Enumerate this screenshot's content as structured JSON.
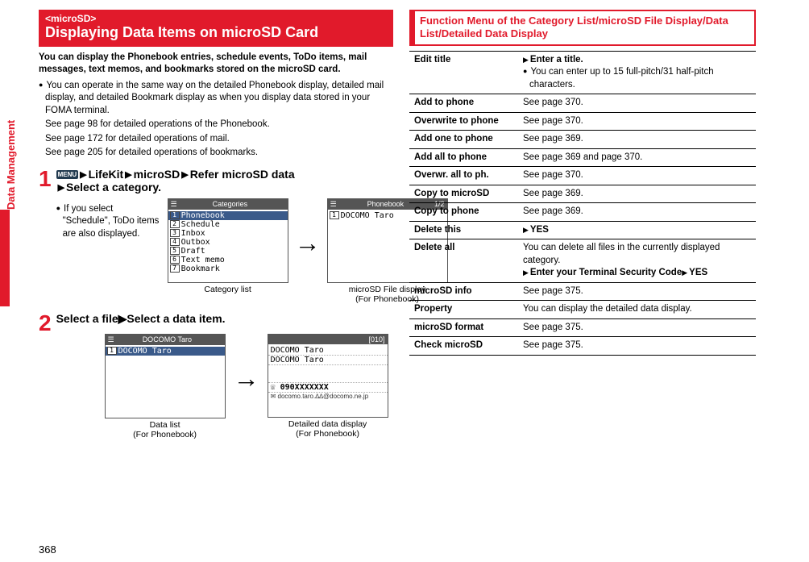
{
  "side": "Data Management",
  "left": {
    "box_tag": "<microSD>",
    "title": "Displaying Data Items on microSD Card",
    "lead": "You can display the Phonebook entries, schedule events, ToDo items, mail messages, text memos, and bookmarks stored on the microSD card.",
    "notes": [
      "You can operate in the same way on the detailed Phonebook display, detailed mail display, and detailed Bookmark display as when you display data stored in your FOMA terminal.",
      "See page 98 for detailed operations of the Phonebook.",
      "See page 172 for detailed operations of mail.",
      "See page 205 for detailed operations of bookmarks."
    ],
    "menu": "MENU",
    "step1a": "LifeKit",
    "step1b": "microSD",
    "step1c": "Refer microSD data",
    "step1d": "Select a category.",
    "step1note": "If you select \"Schedule\", ToDo items are also displayed.",
    "cat_hdr": "Categories",
    "pb_hdr": "Phonebook",
    "pb_ctr": "1/2",
    "cats": [
      "Phonebook",
      "Schedule",
      "Inbox",
      "Outbox",
      "Draft",
      "Text memo",
      "Bookmark"
    ],
    "pb_item": "DOCOMO Taro",
    "cap_cat": "Category list",
    "cap_file": "microSD File display",
    "cap_for": "(For Phonebook)",
    "step2": "Select a file▶Select a data item.",
    "dl_hdr": "DOCOMO Taro",
    "dl_item": "DOCOMO Taro",
    "cap_dl": "Data list",
    "det_mem": "[010]",
    "det_name1": "DOCOMO Taro",
    "det_name2": "DOCOMO Taro",
    "det_phone": "090XXXXXXX",
    "det_mail": "docomo.taro.∆∆@docomo.ne.jp",
    "cap_det": "Detailed data display"
  },
  "right": {
    "title": "Function Menu of the Category List/microSD File Display/Data List/Detailed Data Display",
    "rows": [
      {
        "k": "Edit title",
        "v1": "Enter a title.",
        "v1b": true,
        "v2": "You can enter up to 15 full-pitch/31 half-pitch characters."
      },
      {
        "k": "Add to phone",
        "v1": "See page 370."
      },
      {
        "k": "Overwrite to phone",
        "v1": "See page 370."
      },
      {
        "k": "Add one to phone",
        "v1": "See page 369."
      },
      {
        "k": "Add all to phone",
        "v1": "See page 369 and page 370."
      },
      {
        "k": "Overwr. all to ph.",
        "v1": "See page 370."
      },
      {
        "k": "Copy to microSD",
        "v1": "See page 369."
      },
      {
        "k": "Copy to phone",
        "v1": "See page 369."
      },
      {
        "k": "Delete this",
        "v1": "YES",
        "v1b": true
      },
      {
        "k": "Delete all",
        "v1": "You can delete all files in the currently displayed category.",
        "v3": "Enter your Terminal Security Code",
        "v4": "YES"
      },
      {
        "k": "microSD info",
        "v1": "See page 375."
      },
      {
        "k": "Property",
        "v1": "You can display the detailed data display."
      },
      {
        "k": "microSD format",
        "v1": "See page 375."
      },
      {
        "k": "Check microSD",
        "v1": "See page 375."
      }
    ]
  },
  "page": "368"
}
